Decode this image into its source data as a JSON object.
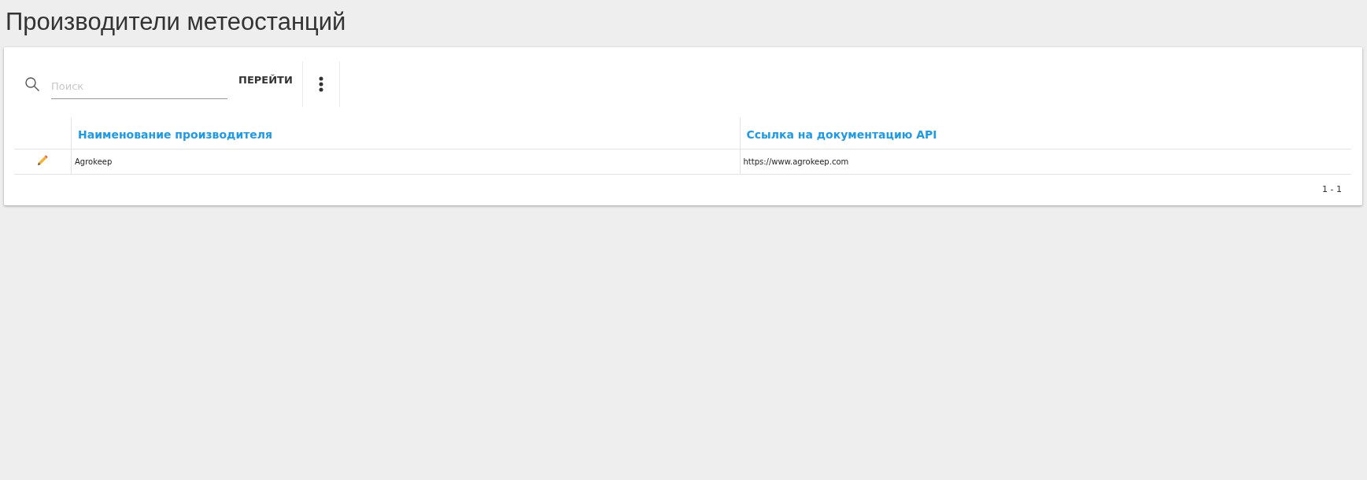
{
  "page_title": "Производители метеостанций",
  "search": {
    "placeholder": "Поиск",
    "button": "ПЕРЕЙТИ"
  },
  "table": {
    "columns": [
      "Наименование производителя",
      "Ссылка на документацию API"
    ],
    "rows": [
      {
        "cells": [
          "Agrokeep",
          "https://www.agrokeep.com"
        ]
      }
    ]
  },
  "pagination": "1 - 1"
}
